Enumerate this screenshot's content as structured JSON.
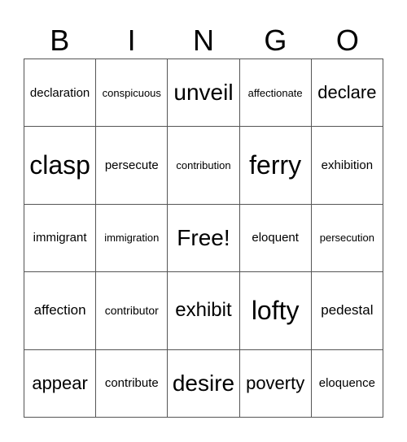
{
  "header": [
    "B",
    "I",
    "N",
    "G",
    "O"
  ],
  "cells": [
    [
      "declaration",
      "conspicuous",
      "unveil",
      "affectionate",
      "declare"
    ],
    [
      "clasp",
      "persecute",
      "contribution",
      "ferry",
      "exhibition"
    ],
    [
      "immigrant",
      "immigration",
      "Free!",
      "eloquent",
      "persecution"
    ],
    [
      "affection",
      "contributor",
      "exhibit",
      "lofty",
      "pedestal"
    ],
    [
      "appear",
      "contribute",
      "desire",
      "poverty",
      "eloquence"
    ]
  ]
}
